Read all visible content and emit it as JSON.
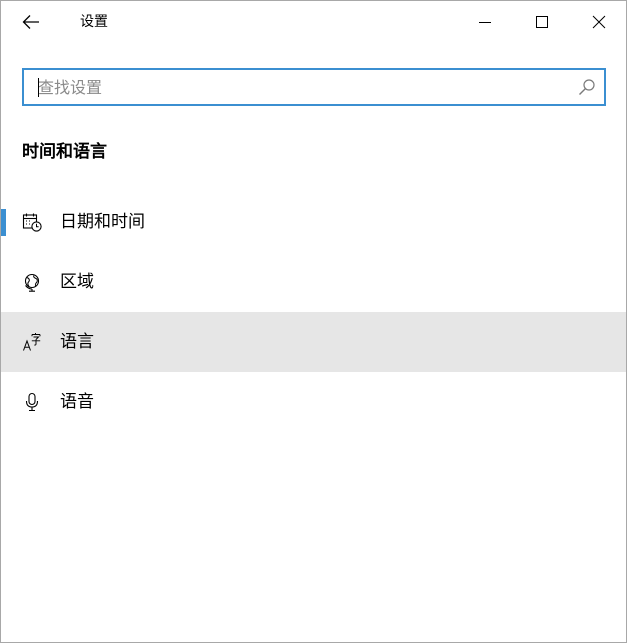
{
  "window": {
    "title": "设置"
  },
  "search": {
    "placeholder": "查找设置",
    "value": ""
  },
  "section": {
    "title": "时间和语言"
  },
  "nav": {
    "items": [
      {
        "label": "日期和时间",
        "icon": "calendar-clock-icon",
        "state": "selected"
      },
      {
        "label": "区域",
        "icon": "globe-icon",
        "state": "normal"
      },
      {
        "label": "语言",
        "icon": "language-icon",
        "state": "hover"
      },
      {
        "label": "语音",
        "icon": "microphone-icon",
        "state": "normal"
      }
    ]
  },
  "colors": {
    "accent": "#3b8fd1",
    "hover_bg": "#e6e6e6"
  }
}
